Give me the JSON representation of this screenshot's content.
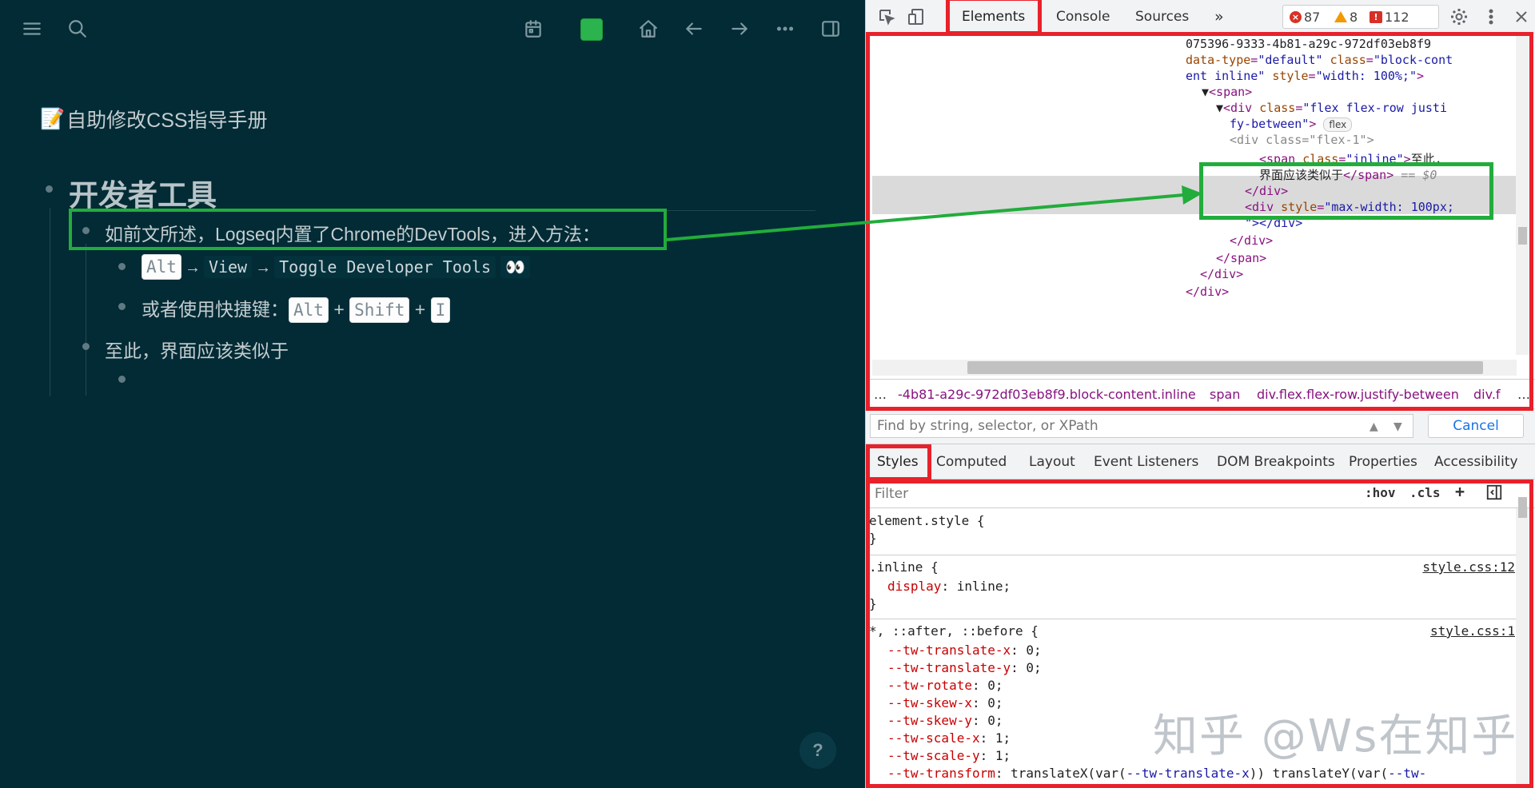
{
  "left_app": {
    "page_title_emoji": "📝",
    "page_title": "自助修改CSS指导手册",
    "heading": "开发者工具",
    "block1": "如前文所述，Logseq内置了Chrome的DevTools，进入方法：",
    "child1": {
      "key": "Alt",
      "arrow1": "→",
      "menu": "View",
      "arrow2": "→",
      "item": "Toggle Developer Tools",
      "emoji": "👀"
    },
    "child2": {
      "text": "或者使用快捷键：",
      "k1": "Alt",
      "plus1": "+",
      "k2": "Shift",
      "plus2": "+",
      "k3": "I"
    },
    "block2": "至此，界面应该类似于",
    "help": "?"
  },
  "devtools": {
    "tabs": [
      "Elements",
      "Console",
      "Sources",
      "»"
    ],
    "badges": {
      "errors": "87",
      "warnings": "8",
      "issues": "112"
    },
    "dom_lines": {
      "l1": "075396-9333-4b81-a29c-972df03eb8f9",
      "l2_attr": "data-type",
      "l2_val": "\"default\"",
      "l2_attr2": "class",
      "l2_val2": "\"block-cont",
      "l3_val": "ent inline\"",
      "l3_attr": "style",
      "l3_val2": "\"width: 100%;\"",
      "l4": "<span>",
      "l5_attr": "class",
      "l5_val": "\"flex flex-row justi",
      "l6_val": "fy-between\"",
      "l6_badge": "flex",
      "l7": "<div class=\"flex-1\">",
      "l8_attr": "class",
      "l8_val": "\"inline\"",
      "l8_text": "至此,",
      "l9_text": "界面应该类似于",
      "l9_close": "</span>",
      "l9_eq": "== $0",
      "l10": "</div>",
      "l11_attr": "style",
      "l11_val": "\"max-width: 100px;",
      "l12": "\"></div>",
      "l13": "</div>",
      "l14": "</span>",
      "l15": "</div>",
      "l16": "</div>"
    },
    "breadcrumb": [
      "…",
      "-4b81-a29c-972df03eb8f9.block-content.inline",
      "span",
      "div.flex.flex-row.justify-between",
      "div.f",
      "…"
    ],
    "find_placeholder": "Find by string, selector, or XPath",
    "cancel": "Cancel",
    "style_tabs": [
      "Styles",
      "Computed",
      "Layout",
      "Event Listeners",
      "DOM Breakpoints",
      "Properties",
      "Accessibility"
    ],
    "filter_placeholder": "Filter",
    "filter_tools": {
      "hov": ":hov",
      "cls": ".cls",
      "plus": "+"
    },
    "rules": {
      "r1_sel": "element.style {",
      "r1_close": "}",
      "r2_sel": ".inline {",
      "r2_src": "style.css:12",
      "r2_prop": "display",
      "r2_val": "inline;",
      "r2_close": "}",
      "r3_sel": "*, ::after, ::before {",
      "r3_src": "style.css:1",
      "r3_props": [
        {
          "p": "--tw-translate-x",
          "v": "0;"
        },
        {
          "p": "--tw-translate-y",
          "v": "0;"
        },
        {
          "p": "--tw-rotate",
          "v": "0;"
        },
        {
          "p": "--tw-skew-x",
          "v": "0;"
        },
        {
          "p": "--tw-skew-y",
          "v": "0;"
        },
        {
          "p": "--tw-scale-x",
          "v": "1;"
        },
        {
          "p": "--tw-scale-y",
          "v": "1;"
        }
      ],
      "r3_last_prop": "--tw-transform",
      "r3_last_val1": "translateX(var(",
      "r3_last_var1": "--tw-translate-x",
      "r3_last_val2": ")) translateY(var(",
      "r3_last_var2": "--tw-"
    }
  },
  "watermark": "知乎 @Ws在知乎",
  "colors": {
    "app_bg": "#022b35",
    "annotation_red": "#e8212b",
    "annotation_green": "#22ac3c",
    "accent_blue": "#1a73e8"
  }
}
